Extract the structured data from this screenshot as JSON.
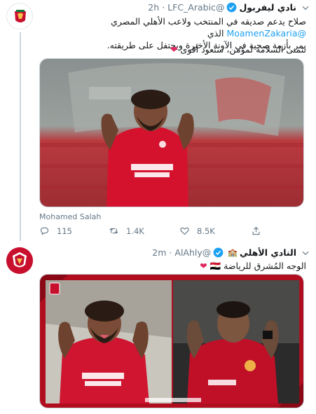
{
  "tweet1": {
    "display_name": "نادي ليفربول",
    "handle": "@LFC_Arabic",
    "dot": "·",
    "time": "2h",
    "text_line1_pre": "صلاح يدعم صديقه في المنتخب ولاعب الأهلي المصري",
    "mention": "@MoamenZakaria",
    "text_line1_post": "الذي",
    "text_line2": "يمر بأزمة صحية في الآونة الأخيرة ويحتفل على طريقته.",
    "text_line3": "نتمنى السلامة لمؤمن، ستعود أقوى",
    "heart": "❤",
    "media_caption": "Mohamed Salah",
    "reply_count": "115",
    "retweet_count": "1.4K",
    "like_count": "8.5K",
    "colors": {
      "lfc_red": "#c8102e"
    }
  },
  "tweet2": {
    "display_name": "النادي الأهلي",
    "badge_emoji": "🏫",
    "handle": "@AlAhly",
    "dot": "·",
    "time": "2m",
    "text": "الوجه المُشرق للرياضة",
    "flag_emoji": "🇪🇬",
    "heart": "❤",
    "colors": {
      "ahly_red": "#c8102e"
    }
  },
  "colors": {
    "link": "#1da1f2",
    "secondary_text": "#657786",
    "border": "#ccd6dd"
  }
}
